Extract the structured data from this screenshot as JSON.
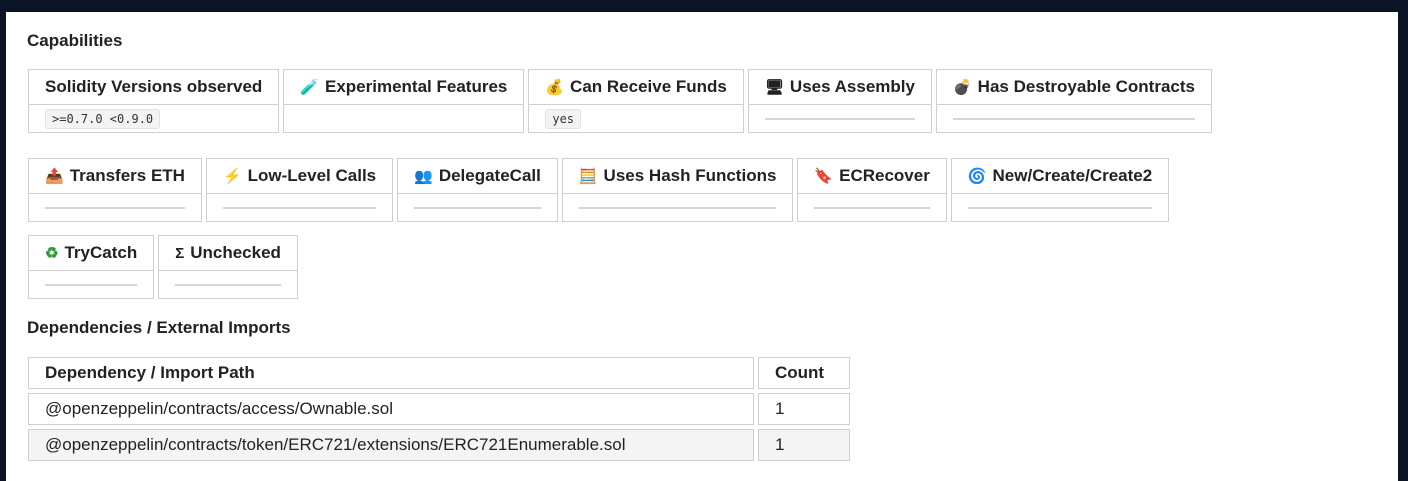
{
  "capabilities_title": "Capabilities",
  "row1": {
    "headers": [
      {
        "icon": "",
        "label": "Solidity Versions observed"
      },
      {
        "icon": "🧪",
        "label": "Experimental Features"
      },
      {
        "icon": "💰",
        "label": "Can Receive Funds"
      },
      {
        "icon": "🖥",
        "label": "Uses Assembly"
      },
      {
        "icon": "💣",
        "label": "Has Destroyable Contracts"
      }
    ],
    "values": [
      ">=0.7.0 <0.9.0",
      "",
      "yes",
      "",
      ""
    ]
  },
  "row2": {
    "headers": [
      {
        "icon": "📤",
        "label": "Transfers ETH"
      },
      {
        "icon": "⚡",
        "label": "Low-Level Calls"
      },
      {
        "icon": "👥",
        "label": "DelegateCall"
      },
      {
        "icon": "🧮",
        "label": "Uses Hash Functions"
      },
      {
        "icon": "🔖",
        "label": "ECRecover"
      },
      {
        "icon": "🌀",
        "label": "New/Create/Create2"
      }
    ]
  },
  "row3": {
    "headers": [
      {
        "icon": "♻",
        "label": "TryCatch"
      },
      {
        "icon": "Σ",
        "label": "Unchecked"
      }
    ]
  },
  "dependencies": {
    "title": "Dependencies / External Imports",
    "col_path": "Dependency / Import Path",
    "col_count": "Count",
    "rows": [
      {
        "path": "@openzeppelin/contracts/access/Ownable.sol",
        "count": "1"
      },
      {
        "path": "@openzeppelin/contracts/token/ERC721/extensions/ERC721Enumerable.sol",
        "count": "1"
      }
    ]
  },
  "colors": {
    "page_background": "#0b1424",
    "panel_background": "#ffffff",
    "border": "#cfcfcf",
    "empty_marker": "#d6d6d6"
  }
}
